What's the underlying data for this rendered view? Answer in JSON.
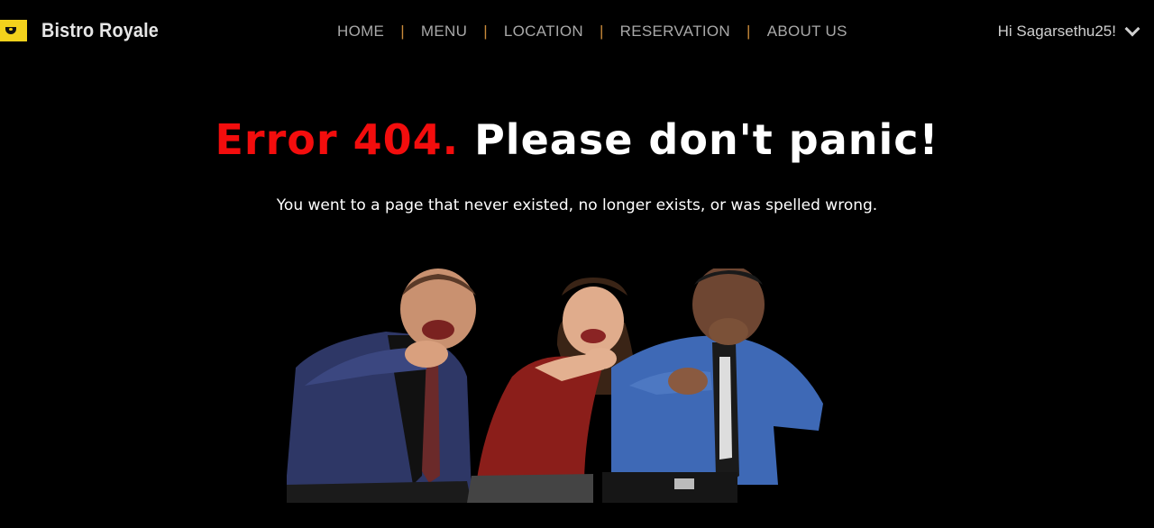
{
  "brand": {
    "name": "Bistro Royale",
    "logo_icon": "bistro-logo-icon",
    "logo_color": "#f3d21c"
  },
  "nav": {
    "items": [
      {
        "label": "HOME"
      },
      {
        "label": "MENU"
      },
      {
        "label": "LOCATION"
      },
      {
        "label": "RESERVATION"
      },
      {
        "label": "ABOUT US"
      }
    ],
    "separator": "|",
    "separator_color": "#c98a3a"
  },
  "user": {
    "greeting": "Hi Sagarsethu25!",
    "menu_icon": "chevron-down-icon"
  },
  "error": {
    "code_text": "Error 404.",
    "headline_text": "Please don't panic!",
    "code_color": "#f30d0d",
    "message": "You went to a page that never existed, no longer exists, or was spelled wrong."
  },
  "image": {
    "subject": "three people laughing and pointing"
  }
}
